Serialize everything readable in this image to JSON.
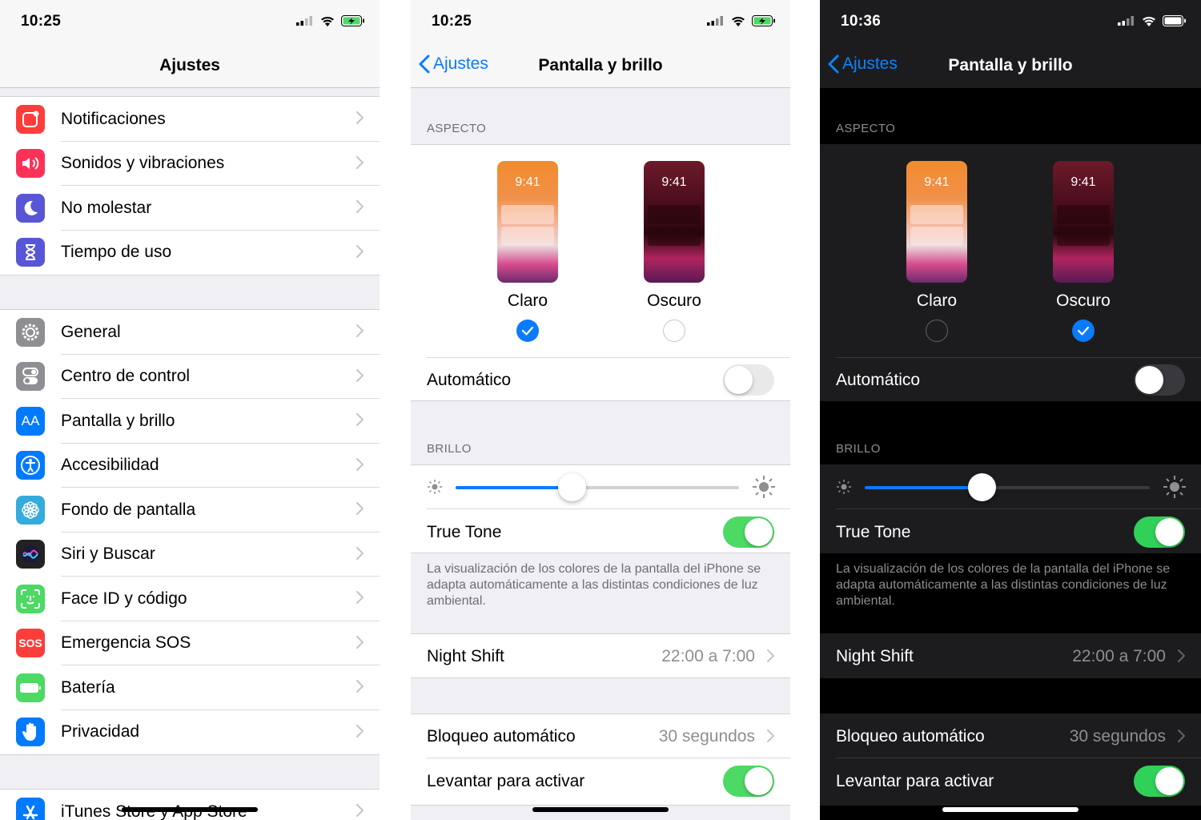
{
  "screens": [
    {
      "time": "10:25",
      "title": "Ajustes",
      "group1": [
        {
          "label": "Notificaciones",
          "icon": "notifications-icon",
          "color": "#fc3d39"
        },
        {
          "label": "Sonidos y vibraciones",
          "icon": "speaker-icon",
          "color": "#fc3158"
        },
        {
          "label": "No molestar",
          "icon": "moon-icon",
          "color": "#5856d6"
        },
        {
          "label": "Tiempo de uso",
          "icon": "hourglass-icon",
          "color": "#5856d6"
        }
      ],
      "group2": [
        {
          "label": "General",
          "icon": "gear-icon",
          "color": "#8e8e93"
        },
        {
          "label": "Centro de control",
          "icon": "toggles-icon",
          "color": "#8e8e93"
        },
        {
          "label": "Pantalla y brillo",
          "icon": "text-size-icon",
          "color": "#007aff",
          "glyph": "AA"
        },
        {
          "label": "Accesibilidad",
          "icon": "accessibility-icon",
          "color": "#007aff"
        },
        {
          "label": "Fondo de pantalla",
          "icon": "flower-icon",
          "color": "#35aadc"
        },
        {
          "label": "Siri y Buscar",
          "icon": "siri-icon",
          "color": "#222"
        },
        {
          "label": "Face ID y código",
          "icon": "faceid-icon",
          "color": "#4cd964"
        },
        {
          "label": "Emergencia SOS",
          "icon": "sos-icon",
          "color": "#fc3d39",
          "glyph": "SOS"
        },
        {
          "label": "Batería",
          "icon": "battery-icon",
          "color": "#4cd964"
        },
        {
          "label": "Privacidad",
          "icon": "hand-icon",
          "color": "#007aff"
        }
      ],
      "group3": [
        {
          "label": "iTunes Store y App Store",
          "icon": "appstore-icon",
          "color": "#007aff"
        }
      ]
    },
    {
      "time": "10:25",
      "back": "Ajustes",
      "title": "Pantalla y brillo",
      "aspect_header": "ASPECTO",
      "preview_time": "9:41",
      "light_label": "Claro",
      "dark_label": "Oscuro",
      "selected": "Claro",
      "auto_label": "Automático",
      "brightness_header": "BRILLO",
      "brightness_level": 0.41,
      "truetone_label": "True Tone",
      "truetone_footer": "La visualización de los colores de la pantalla del iPhone se adapta automáticamente a las distintas condiciones de luz ambiental.",
      "nightshift_label": "Night Shift",
      "nightshift_value": "22:00 a 7:00",
      "autolock_label": "Bloqueo automático",
      "autolock_value": "30 segundos",
      "raise_label": "Levantar para activar"
    },
    {
      "time": "10:36",
      "back": "Ajustes",
      "title": "Pantalla y brillo",
      "aspect_header": "ASPECTO",
      "preview_time": "9:41",
      "light_label": "Claro",
      "dark_label": "Oscuro",
      "selected": "Oscuro",
      "auto_label": "Automático",
      "brightness_header": "BRILLO",
      "brightness_level": 0.41,
      "truetone_label": "True Tone",
      "truetone_footer": "La visualización de los colores de la pantalla del iPhone se adapta automáticamente a las distintas condiciones de luz ambiental.",
      "nightshift_label": "Night Shift",
      "nightshift_value": "22:00 a 7:00",
      "autolock_label": "Bloqueo automático",
      "autolock_value": "30 segundos",
      "raise_label": "Levantar para activar"
    }
  ]
}
